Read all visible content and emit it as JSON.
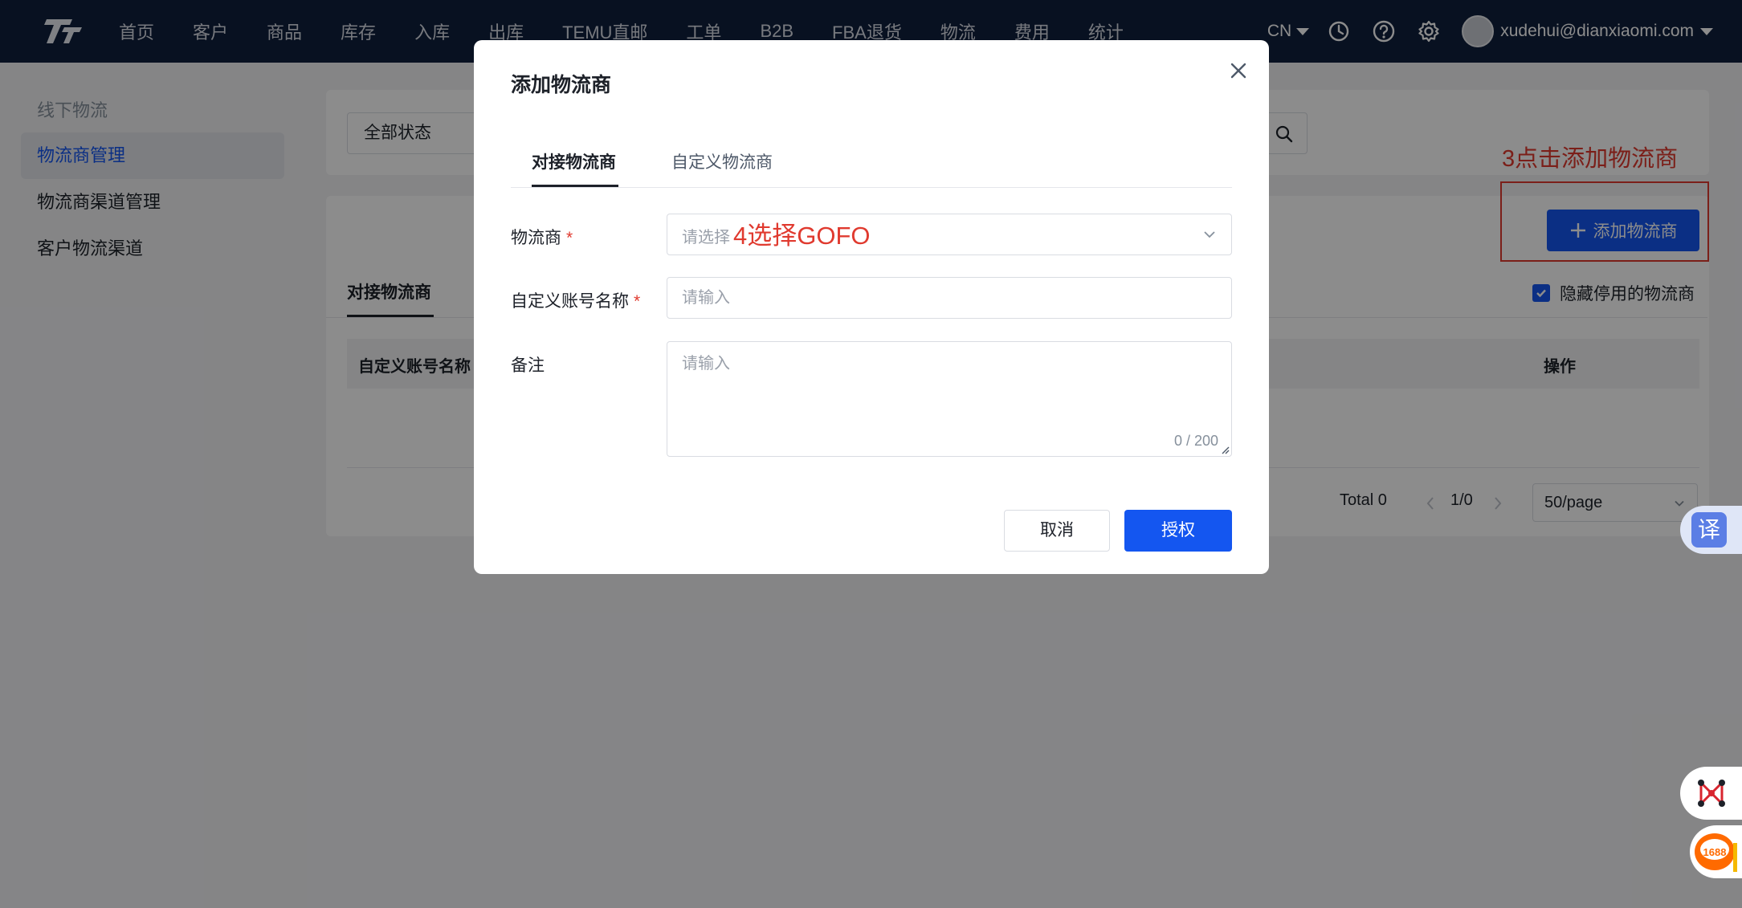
{
  "nav": {
    "items": [
      "首页",
      "客户",
      "商品",
      "库存",
      "入库",
      "出库",
      "TEMU直邮",
      "工单",
      "B2B",
      "FBA退货",
      "物流",
      "费用",
      "统计"
    ],
    "lang": "CN",
    "user_email": "xudehui@dianxiaomi.com"
  },
  "sidebar": {
    "group": "线下物流",
    "items": [
      "物流商管理",
      "物流商渠道管理",
      "客户物流渠道"
    ]
  },
  "filter": {
    "status_value": "全部状态"
  },
  "actions": {
    "add_button": "添加物流商",
    "annotation_3": "3点击添加物流商"
  },
  "tabs": {
    "integrated": "对接物流商"
  },
  "options": {
    "hide_disabled": "隐藏停用的物流商"
  },
  "table": {
    "headers": [
      "自定义账号名称",
      "操作"
    ]
  },
  "pagination": {
    "total": "Total 0",
    "page": "1/0",
    "page_size": "50/page"
  },
  "floaters": {
    "translate": "译",
    "badge_1688": "1688"
  },
  "modal": {
    "title": "添加物流商",
    "tabs": [
      "对接物流商",
      "自定义物流商"
    ],
    "fields": {
      "carrier_label": "物流商",
      "carrier_placeholder": "请选择",
      "carrier_annotation": "4选择GOFO",
      "account_label": "自定义账号名称",
      "account_placeholder": "请输入",
      "remark_label": "备注",
      "remark_placeholder": "请输入",
      "remark_counter": "0 / 200"
    },
    "required_mark": "*",
    "cancel": "取消",
    "confirm": "授权"
  },
  "colors": {
    "primary": "#1456f0",
    "annotation_red": "#e03a2f",
    "topbar": "#0f1f3d"
  }
}
